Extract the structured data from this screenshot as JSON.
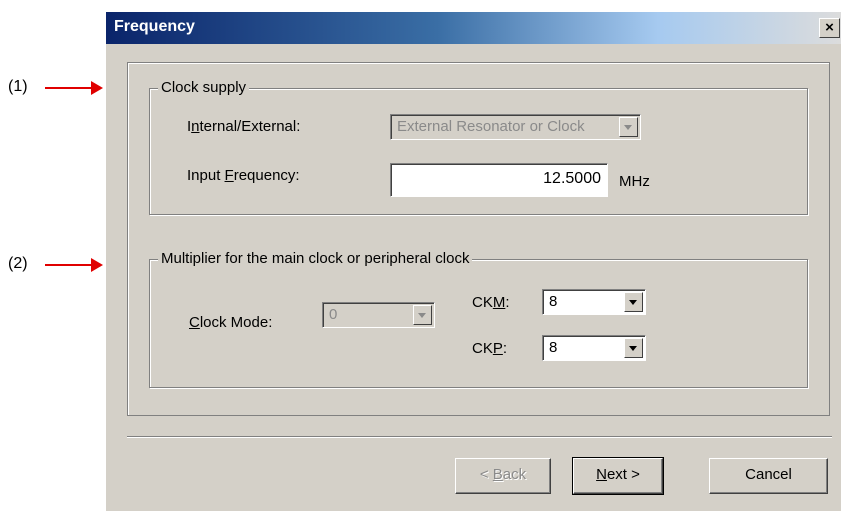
{
  "annotations": [
    "(1)",
    "(2)"
  ],
  "colors": {
    "arrow": "#e00000",
    "title_bar": "#0a246a",
    "dialog_bg": "#d4d0c8"
  },
  "window": {
    "title": "Frequency",
    "close_glyph": "×"
  },
  "clock_supply": {
    "legend": "Clock supply",
    "internal_external": {
      "label_pre": "I",
      "label_key": "n",
      "label_post": "ternal/External:",
      "value": "External Resonator or Clock",
      "disabled": true
    },
    "input_frequency": {
      "label_pre": "Input ",
      "label_key": "F",
      "label_post": "requency:",
      "value": "12.5000",
      "unit": "MHz"
    }
  },
  "multiplier": {
    "legend": "Multiplier for the main clock or peripheral clock",
    "clock_mode": {
      "label_key": "C",
      "label_post": "lock Mode:",
      "value": "0",
      "disabled": true
    },
    "ckm": {
      "label_pre": "CK",
      "label_key": "M",
      "label_post": ":",
      "value": "8"
    },
    "ckp": {
      "label_pre": "CK",
      "label_key": "P",
      "label_post": ":",
      "value": "8"
    }
  },
  "buttons": {
    "back": {
      "pre": "< ",
      "key": "B",
      "post": "ack",
      "disabled": true
    },
    "next": {
      "key": "N",
      "post": "ext >"
    },
    "cancel": {
      "label": "Cancel"
    }
  },
  "icons": {
    "dropdown": "chevron-down-icon",
    "close": "close-icon",
    "arrow": "arrow-right-icon"
  }
}
